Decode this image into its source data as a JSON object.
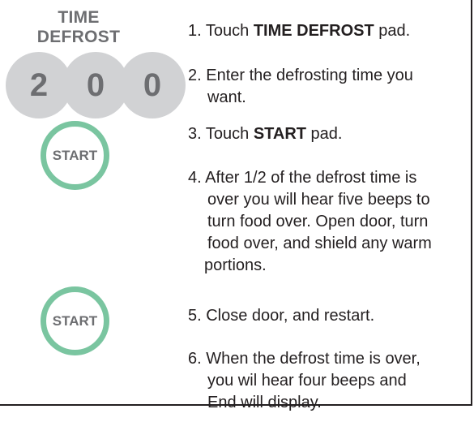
{
  "pad": {
    "label_line1": "TIME",
    "label_line2": "DEFROST",
    "digits": [
      "2",
      "0",
      "0"
    ],
    "start_label": "START",
    "restart_label": "START"
  },
  "steps": [
    {
      "prefix": "1. Touch ",
      "bold": "TIME DEFROST",
      "suffix": " pad."
    },
    {
      "line1": "2. Enter the defrosting time you",
      "line2": "want."
    },
    {
      "prefix": "3. Touch ",
      "bold": "START",
      "suffix": " pad."
    },
    {
      "line1": "4. After 1/2 of the defrost time is",
      "line2": "over you will hear five beeps to",
      "line3": "turn food over. Open door, turn",
      "line4": "food over, and shield any warm",
      "line5": "portions."
    },
    {
      "line1": "5. Close door, and restart."
    },
    {
      "line1": "6. When the defrost time is over,",
      "line2": "you wil hear four beeps and",
      "line3": "End will display."
    }
  ],
  "colors": {
    "digit_fill": "#d1d2d4",
    "pad_text": "#6d6e71",
    "start_ring": "#7ac5a0",
    "body_text": "#231f20"
  }
}
